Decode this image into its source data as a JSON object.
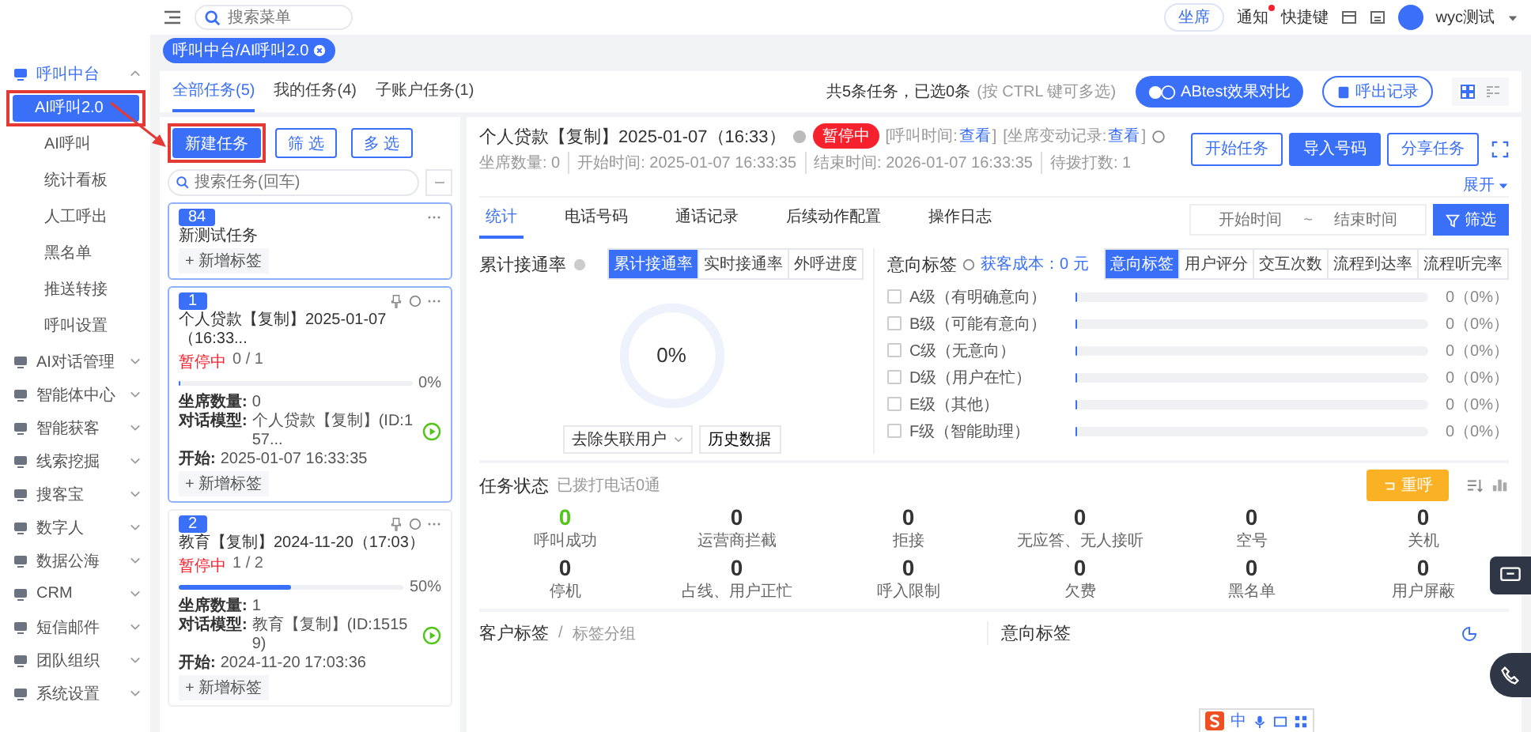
{
  "topbar": {
    "search_placeholder": "搜索菜单",
    "actions": [
      {
        "label": "坐席",
        "badge": false
      },
      {
        "label": "通知",
        "badge": true
      },
      {
        "label": "快捷键",
        "badge": false
      }
    ],
    "user": "wyc测试"
  },
  "breadcrumb": "呼叫中台/AI呼叫2.0",
  "sidebar": {
    "items": [
      {
        "label": "呼叫中台",
        "expanded": true,
        "selected": true,
        "children": [
          {
            "label": "AI呼叫2.0",
            "selected": true,
            "highlighted": true
          },
          {
            "label": "AI呼叫",
            "selected": false,
            "highlighted": false
          },
          {
            "label": "统计看板",
            "selected": false,
            "highlighted": false
          },
          {
            "label": "人工呼出",
            "selected": false,
            "highlighted": false
          },
          {
            "label": "黑名单",
            "selected": false,
            "highlighted": false
          },
          {
            "label": "推送转接",
            "selected": false,
            "highlighted": false
          },
          {
            "label": "呼叫设置",
            "selected": false,
            "highlighted": false
          }
        ]
      },
      {
        "label": "AI对话管理",
        "expanded": false,
        "selected": false
      },
      {
        "label": "智能体中心",
        "expanded": false,
        "selected": false
      },
      {
        "label": "智能获客",
        "expanded": false,
        "selected": false
      },
      {
        "label": "线索挖掘",
        "expanded": false,
        "selected": false
      },
      {
        "label": "搜客宝",
        "expanded": false,
        "selected": false
      },
      {
        "label": "数字人",
        "expanded": false,
        "selected": false
      },
      {
        "label": "数据公海",
        "expanded": false,
        "selected": false
      },
      {
        "label": "CRM",
        "expanded": false,
        "selected": false
      },
      {
        "label": "短信邮件",
        "expanded": false,
        "selected": false
      },
      {
        "label": "团队组织",
        "expanded": false,
        "selected": false
      },
      {
        "label": "系统设置",
        "expanded": false,
        "selected": false
      }
    ]
  },
  "task_tabs": [
    {
      "label": "全部任务(5)",
      "selected": true
    },
    {
      "label": "我的任务(4)",
      "selected": false
    },
    {
      "label": "子账户任务(1)",
      "selected": false
    }
  ],
  "selection_summary": "共5条任务，已选0条",
  "selection_hint": "(按 CTRL 键可多选)",
  "view_modes": [
    {
      "kind": "grid",
      "selected": true
    },
    {
      "kind": "list",
      "selected": false
    }
  ],
  "toolbar_buttons": [
    {
      "label": "ABtest效果对比",
      "kind": "abtest"
    },
    {
      "label": "呼出记录",
      "kind": "record"
    }
  ],
  "task_list": {
    "buttons": [
      {
        "label": "新建任务",
        "kind": "primary",
        "highlighted": true
      },
      {
        "label": "筛 选",
        "kind": "outline",
        "highlighted": false
      },
      {
        "label": "多 选",
        "kind": "outline",
        "highlighted": false
      }
    ],
    "search_placeholder": "搜索任务(回车)",
    "tasks": [
      {
        "number": "84",
        "title": "新测试任务",
        "selected": true,
        "tag_button": "+ 新增标签"
      },
      {
        "number": "1",
        "title": "个人贷款【复制】2025-01-07（16:33...",
        "selected": true,
        "status": "暂停中",
        "progress": "0 / 1",
        "level": 0,
        "percent": "0%",
        "fields": [
          {
            "label": "坐席数量:",
            "value": "0"
          },
          {
            "label": "对话模型:",
            "value": "个人贷款【复制】(ID:157..."
          },
          {
            "label": "开始:",
            "value": "2025-01-07 16:33:35"
          }
        ],
        "tag_button": "+ 新增标签"
      },
      {
        "number": "2",
        "title": "教育【复制】2024-11-20（17:03）",
        "selected": false,
        "status": "暂停中",
        "progress": "1 / 2",
        "level": 0.5,
        "percent": "50%",
        "fields": [
          {
            "label": "坐席数量:",
            "value": "1"
          },
          {
            "label": "对话模型:",
            "value": "教育【复制】(ID:15159)"
          },
          {
            "label": "开始:",
            "value": "2024-11-20 17:03:36"
          }
        ],
        "tag_button": "+ 新增标签"
      }
    ]
  },
  "detail": {
    "title": "个人贷款【复制】2025-01-07（16:33）",
    "status": "暂停中",
    "links": [
      {
        "prefix": "[呼叫时间:",
        "link": "查看",
        "suffix": "]"
      },
      {
        "prefix": "[坐席变动记录:",
        "link": "查看",
        "suffix": "]"
      }
    ],
    "meta": [
      "坐席数量: 0",
      "开始时间: 2025-01-07 16:33:35",
      "结束时间: 2026-01-07 16:33:35",
      "待拨打数: 1"
    ],
    "actions": [
      {
        "label": "开始任务",
        "kind": "outline"
      },
      {
        "label": "导入号码",
        "kind": "primary"
      },
      {
        "label": "分享任务",
        "kind": "outline"
      }
    ],
    "expand": "展开",
    "tabs": [
      {
        "label": "统计",
        "selected": true
      },
      {
        "label": "电话号码",
        "selected": false
      },
      {
        "label": "通话记录",
        "selected": false
      },
      {
        "label": "后续动作配置",
        "selected": false
      },
      {
        "label": "操作日志",
        "selected": false
      }
    ],
    "date_range": {
      "start_placeholder": "开始时间",
      "separator": "~",
      "end_placeholder": "结束时间"
    },
    "filter_button": "筛选"
  },
  "rate_card": {
    "title": "累计接通率",
    "segments": [
      {
        "label": "累计接通率",
        "selected": true
      },
      {
        "label": "实时接通率",
        "selected": false
      },
      {
        "label": "外呼进度",
        "selected": false
      }
    ],
    "value": "0%",
    "level": 0,
    "dropdown": "去除失联用户",
    "history_button": "历史数据"
  },
  "intent_card": {
    "title": "意向标签",
    "cost": "获客成本：0 元",
    "segments": [
      {
        "label": "意向标签",
        "selected": true
      },
      {
        "label": "用户评分",
        "selected": false
      },
      {
        "label": "交互次数",
        "selected": false
      },
      {
        "label": "流程到达率",
        "selected": false
      },
      {
        "label": "流程听完率",
        "selected": false
      }
    ],
    "rows": [
      {
        "label": "A级（有明确意向）",
        "checked": false,
        "level": 0,
        "reading": "0（0%）"
      },
      {
        "label": "B级（可能有意向）",
        "checked": false,
        "level": 0,
        "reading": "0（0%）"
      },
      {
        "label": "C级（无意向）",
        "checked": false,
        "level": 0,
        "reading": "0（0%）"
      },
      {
        "label": "D级（用户在忙）",
        "checked": false,
        "level": 0,
        "reading": "0（0%）"
      },
      {
        "label": "E级（其他）",
        "checked": false,
        "level": 0,
        "reading": "0（0%）"
      },
      {
        "label": "F级（智能助理）",
        "checked": false,
        "level": 0,
        "reading": "0（0%）"
      }
    ]
  },
  "task_status": {
    "title": "任务状态",
    "subtitle": "已拨打电话0通",
    "redial_button": "重呼",
    "stats": [
      {
        "value": "0",
        "label": "呼叫成功",
        "color": "#52c41a"
      },
      {
        "value": "0",
        "label": "运营商拦截",
        "color": "#333333"
      },
      {
        "value": "0",
        "label": "拒接",
        "color": "#333333"
      },
      {
        "value": "0",
        "label": "无应答、无人接听",
        "color": "#333333"
      },
      {
        "value": "0",
        "label": "空号",
        "color": "#333333"
      },
      {
        "value": "0",
        "label": "关机",
        "color": "#333333"
      },
      {
        "value": "0",
        "label": "停机",
        "color": "#333333"
      },
      {
        "value": "0",
        "label": "占线、用户正忙",
        "color": "#333333"
      },
      {
        "value": "0",
        "label": "呼入限制",
        "color": "#333333"
      },
      {
        "value": "0",
        "label": "欠费",
        "color": "#333333"
      },
      {
        "value": "0",
        "label": "黑名单",
        "color": "#333333"
      },
      {
        "value": "0",
        "label": "用户屏蔽",
        "color": "#333333"
      }
    ]
  },
  "bottom": {
    "customer_tags": {
      "title": "客户标签",
      "separator": "/",
      "subtitle": "标签分组"
    },
    "intent_tags": {
      "title": "意向标签"
    }
  },
  "ime": {
    "label": "中"
  }
}
